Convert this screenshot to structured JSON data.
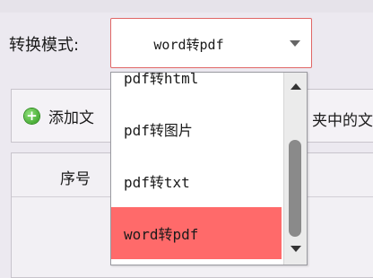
{
  "colors": {
    "accent": "#ff6a6a",
    "combo_border": "#e06666"
  },
  "mode": {
    "label": "转换模式:",
    "selected_value": "word转pdf"
  },
  "toolbar": {
    "add_label": "添加文",
    "folder_tail": "夹中的文"
  },
  "table": {
    "columns": [
      "序号"
    ]
  },
  "dropdown": {
    "options": [
      {
        "label": "pdf转html",
        "selected": false
      },
      {
        "label": "pdf转图片",
        "selected": false
      },
      {
        "label": "pdf转txt",
        "selected": false
      },
      {
        "label": "word转pdf",
        "selected": true
      }
    ]
  }
}
